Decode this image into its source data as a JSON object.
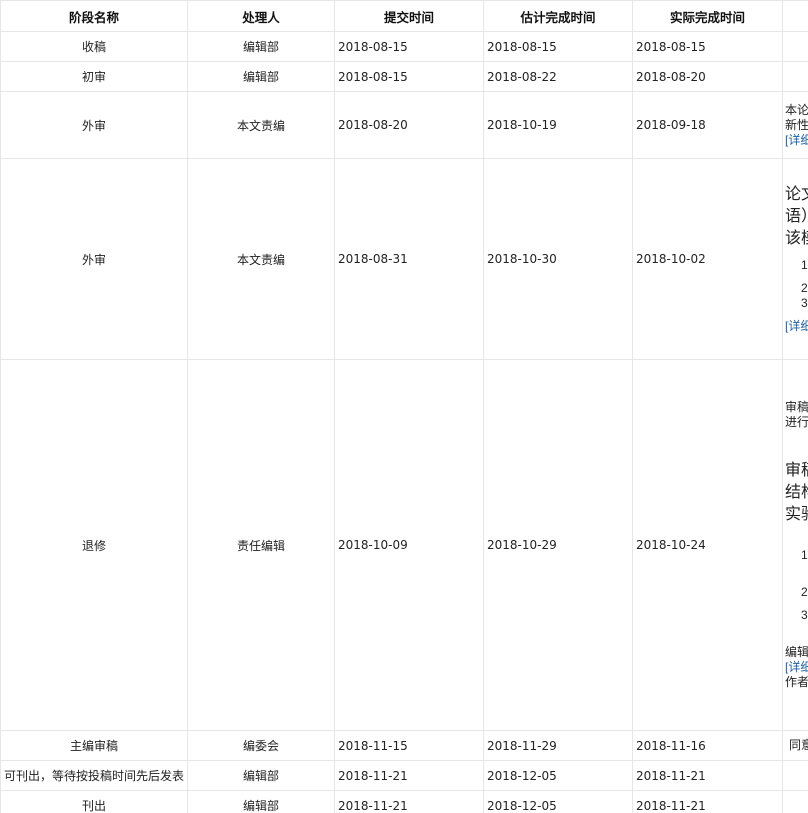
{
  "table": {
    "headers": [
      "阶段名称",
      "处理人",
      "提交时间",
      "估计完成时间",
      "实际完成时间",
      ""
    ],
    "rows": [
      {
        "stage": "收稿",
        "handler": "编辑部",
        "submit": "2018-08-15",
        "estimate": "2018-08-15",
        "actual": "2018-08-15"
      },
      {
        "stage": "初审",
        "handler": "编辑部",
        "submit": "2018-08-15",
        "estimate": "2018-08-22",
        "actual": "2018-08-20"
      },
      {
        "stage": "外审",
        "handler": "本文责编",
        "submit": "2018-08-20",
        "estimate": "2018-10-19",
        "actual": "2018-09-18",
        "note": {
          "l1": "本论",
          "l2": "新性",
          "link": "[详细"
        }
      },
      {
        "stage": "外审",
        "handler": "本文责编",
        "submit": "2018-08-31",
        "estimate": "2018-10-30",
        "actual": "2018-10-02",
        "note": {
          "big1": "论文",
          "big2": "语）",
          "big3": "该模",
          "n1": "1.",
          "n2": "2.",
          "n3": "3.",
          "link": "[详细"
        }
      },
      {
        "stage": "退修",
        "handler": "责任编辑",
        "submit": "2018-10-09",
        "estimate": "2018-10-29",
        "actual": "2018-10-24",
        "note": {
          "l1": "审稿",
          "l2": "进行",
          "big1": "审稿",
          "big2": "结构",
          "big3": "实验",
          "n1": "1.",
          "n2": "2.",
          "n3": "3.",
          "l3": "编辑",
          "link": "[详细",
          "l4": "作者,"
        }
      },
      {
        "stage": "主编审稿",
        "handler": "编委会",
        "submit": "2018-11-15",
        "estimate": "2018-11-29",
        "actual": "2018-11-16",
        "note": {
          "l1": "同意"
        }
      },
      {
        "stage": "可刊出，等待按投稿时间先后发表",
        "handler": "编辑部",
        "submit": "2018-11-21",
        "estimate": "2018-12-05",
        "actual": "2018-11-21"
      },
      {
        "stage": "刊出",
        "handler": "编辑部",
        "submit": "2018-11-21",
        "estimate": "2018-12-05",
        "actual": "2018-11-21"
      }
    ]
  },
  "colors": {
    "link": "#1b5fa8",
    "border": "#e6e6e6"
  }
}
